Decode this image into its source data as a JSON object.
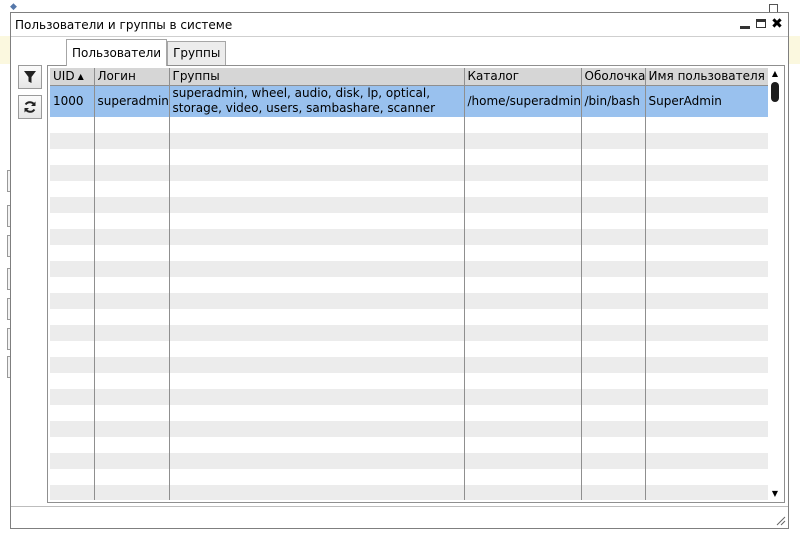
{
  "window": {
    "title": "Пользователи и группы в системе",
    "close_glyph": "✖"
  },
  "tabs": [
    {
      "label": "Пользователи",
      "active": true
    },
    {
      "label": "Группы",
      "active": false
    }
  ],
  "toolbar": {
    "filter_icon": "filter-icon",
    "refresh_icon": "refresh-icon"
  },
  "table": {
    "columns": [
      {
        "label": "UID",
        "sorted": "asc"
      },
      {
        "label": "Логин"
      },
      {
        "label": "Группы"
      },
      {
        "label": "Каталог"
      },
      {
        "label": "Оболочка"
      },
      {
        "label": "Имя пользователя"
      }
    ],
    "rows": [
      {
        "uid": "1000",
        "login": "superadmin",
        "groups": "superadmin, wheel, audio, disk, lp, optical, storage, video, users, sambashare, scanner",
        "home": "/home/superadmin",
        "shell": "/bin/bash",
        "name": "SuperAdmin",
        "selected": true
      }
    ]
  },
  "colors": {
    "selection": "#99c1ee",
    "header": "#d6d6d6",
    "stripe": "#ececec"
  },
  "scrollbar": {
    "up": "▲",
    "down": "▼"
  }
}
